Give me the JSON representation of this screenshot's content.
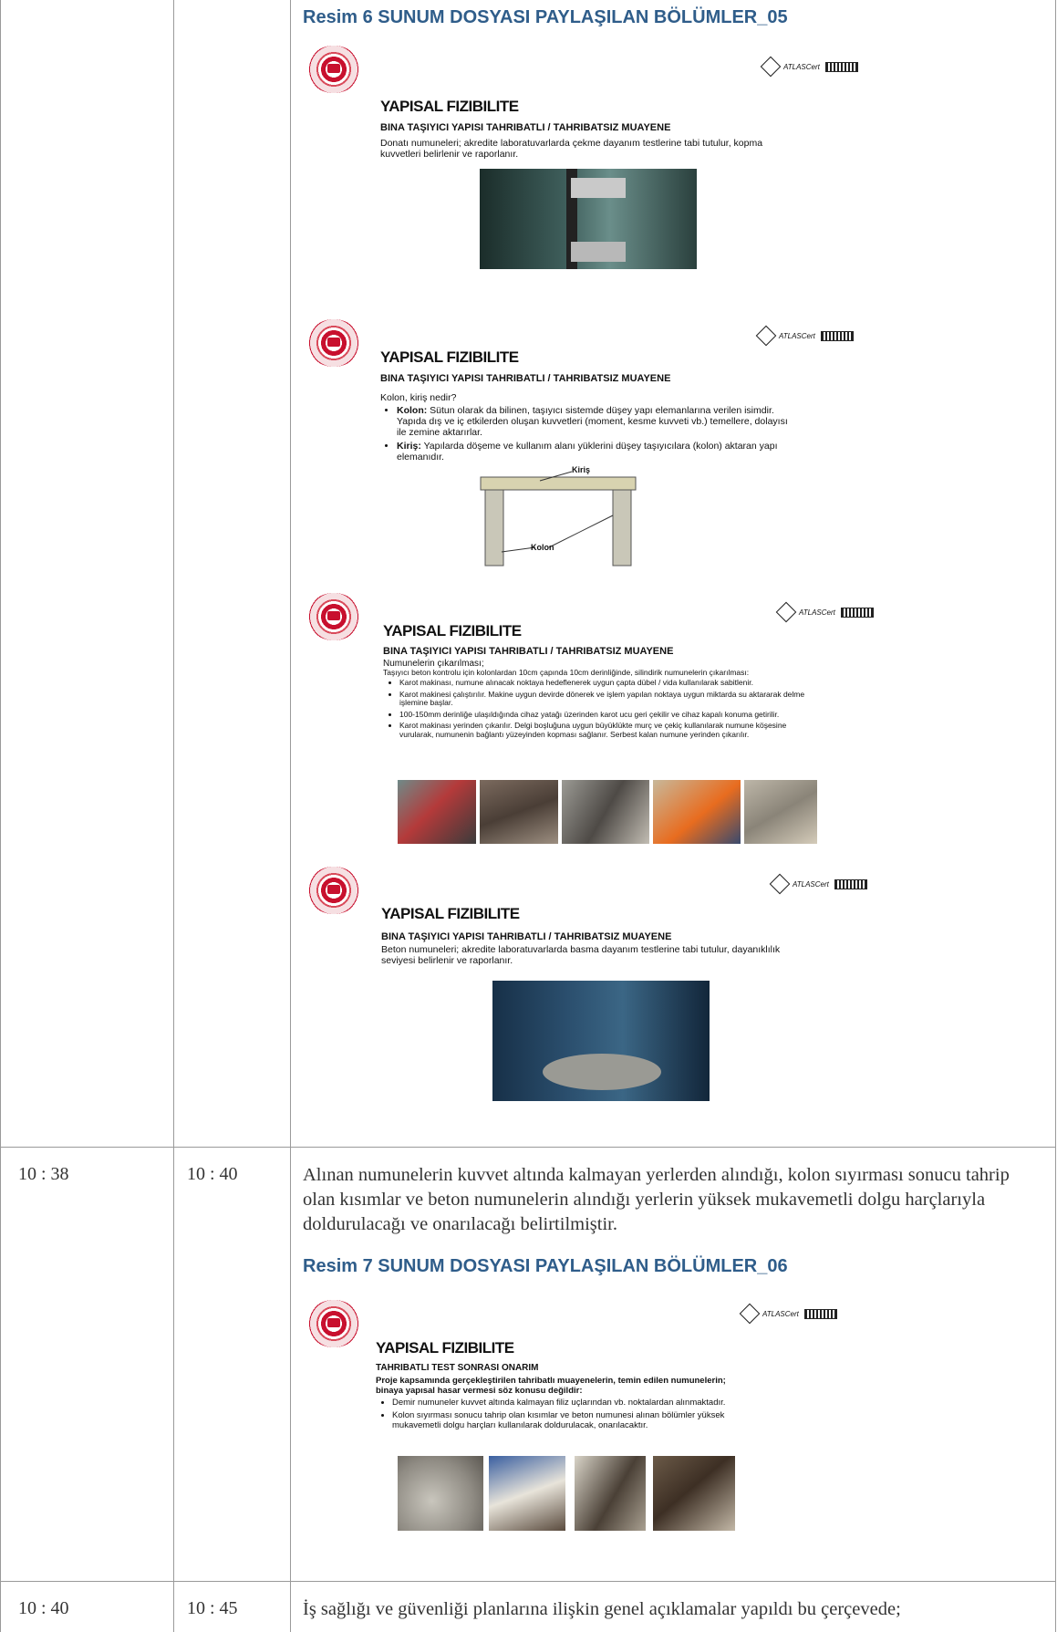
{
  "rows": [
    {
      "start": "",
      "end": "",
      "caption": "Resim 6 SUNUM DOSYASI PAYLAŞILAN BÖLÜMLER_05",
      "slides": [
        {
          "logo_text": "ATLASCert",
          "title": "YAPISAL FIZIBILITE",
          "subtitle": "BINA TAŞIYICI YAPISI TAHRIBATLI / TAHRIBATSIZ MUAYENE",
          "text": "Donatı numuneleri; akredite laboratuvarlarda çekme dayanım testlerine tabi tutulur, kopma kuvvetleri belirlenir ve raporlanır."
        },
        {
          "logo_text": "ATLASCert",
          "title": "YAPISAL FIZIBILITE",
          "subtitle": "BINA TAŞIYICI YAPISI TAHRIBATLI / TAHRIBATSIZ MUAYENE",
          "intro": "Kolon, kiriş nedir?",
          "bullets": [
            {
              "term": "Kolon:",
              "text": " Sütun olarak da bilinen, taşıyıcı sistemde düşey yapı elemanlarına verilen isimdir. Yapıda dış ve iç etkilerden oluşan kuvvetleri (moment, kesme kuvveti vb.) temellere, dolayısı ile zemine aktarırlar."
            },
            {
              "term": "Kiriş:",
              "text": " Yapılarda döşeme ve kullanım alanı yüklerini düşey taşıyıcılara (kolon) aktaran yapı elemanıdır."
            }
          ],
          "diagram_labels": [
            "Kiriş",
            "Kolon"
          ]
        },
        {
          "logo_text": "ATLASCert",
          "title": "YAPISAL FIZIBILITE",
          "subtitle": "BINA TAŞIYICI YAPISI TAHRIBATLI / TAHRIBATSIZ MUAYENE",
          "intro": "Numunelerin çıkarılması;",
          "lead": "Taşıyıcı beton kontrolu için kolonlardan 10cm çapında 10cm derinliğinde, silindirik numunelerin çıkarılması:",
          "bullets": [
            "Karot makinası, numune alınacak noktaya hedeflenerek uygun çapta dübel / vida kullanılarak sabitlenir.",
            "Karot makinesi çalıştırılır. Makine uygun devirde dönerek ve işlem yapılan noktaya uygun miktarda su aktararak delme işlemine başlar.",
            "100-150mm derinliğe ulaşıldığında cihaz yatağı üzerinden karot ucu geri çekilir ve cihaz kapalı konuma getirilir.",
            "Karot makinası yerinden çıkarılır. Delgi boşluğuna uygun büyüklükte murç ve çekiç kullanılarak numune köşesine vurularak, numunenin bağlantı yüzeyinden kopması sağlanır. Serbest kalan numune yerinden çıkarılır."
          ]
        },
        {
          "logo_text": "ATLASCert",
          "title": "YAPISAL FIZIBILITE",
          "subtitle": "BINA TAŞIYICI YAPISI TAHRIBATLI / TAHRIBATSIZ MUAYENE",
          "text": "Beton numuneleri; akredite laboratuvarlarda basma dayanım testlerine tabi tutulur, dayanıklılık seviyesi belirlenir ve raporlanır."
        }
      ]
    },
    {
      "start": "10 : 38",
      "end": "10 : 40",
      "paragraph": "Alınan numunelerin kuvvet altında kalmayan yerlerden alındığı, kolon sıyırması sonucu tahrip olan kısımlar ve beton numunelerin alındığı yerlerin yüksek mukavemetli dolgu harçlarıyla doldurulacağı ve onarılacağı belirtilmiştir.",
      "caption": "Resim 7 SUNUM DOSYASI PAYLAŞILAN BÖLÜMLER_06",
      "slide": {
        "logo_text": "ATLASCert",
        "title": "YAPISAL FIZIBILITE",
        "subtitle": "TAHRIBATLI TEST SONRASI ONARIM",
        "bold_text": "Proje kapsamında gerçekleştirilen tahribatlı muayenelerin, temin edilen numunelerin; binaya yapısal hasar vermesi söz konusu değildir:",
        "bullets": [
          "Demir numuneler kuvvet altında kalmayan filiz uçlarından vb. noktalardan alınmaktadır.",
          "Kolon sıyırması sonucu tahrip olan kısımlar ve beton numunesi alınan bölümler yüksek mukavemetli dolgu harçları kullanılarak doldurulacak, onarılacaktır."
        ]
      }
    },
    {
      "start": "10 : 40",
      "end": "10 : 45",
      "paragraph": "İş sağlığı ve güvenliği planlarına ilişkin genel açıklamalar yapıldı bu çerçevede;"
    }
  ],
  "colors": {
    "grid": "#9a9a9a",
    "caption": "#2f5d8a",
    "seal": "#c8102e"
  }
}
